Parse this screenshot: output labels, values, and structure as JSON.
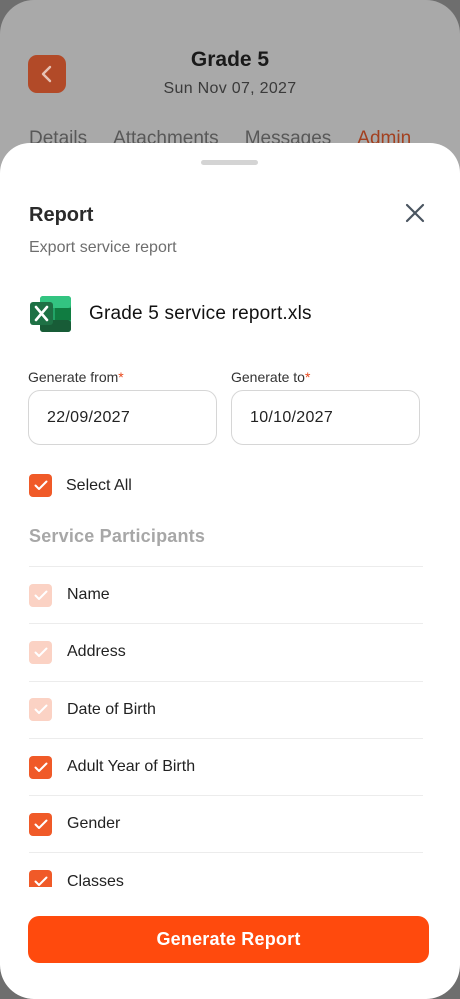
{
  "header": {
    "title": "Grade 5",
    "date": "Sun Nov 07, 2027",
    "tabs": [
      {
        "label": "Details"
      },
      {
        "label": "Attachments"
      },
      {
        "label": "Messages"
      },
      {
        "label": "Admin",
        "active": true
      }
    ]
  },
  "sheet": {
    "title": "Report",
    "subtitle": "Export service report",
    "file_name": "Grade 5 service report.xls",
    "file_icon": "excel-icon",
    "from_label": "Generate from",
    "from_value": "22/09/2027",
    "to_label": "Generate to",
    "to_value": "10/10/2027",
    "required_mark": "*",
    "select_all_label": "Select All",
    "section_title": "Service Participants",
    "items": [
      {
        "label": "Name",
        "checked": true,
        "disabled": true
      },
      {
        "label": "Address",
        "checked": true,
        "disabled": true
      },
      {
        "label": "Date of Birth",
        "checked": true,
        "disabled": true
      },
      {
        "label": "Adult Year of Birth",
        "checked": true,
        "disabled": false
      },
      {
        "label": "Gender",
        "checked": true,
        "disabled": false
      },
      {
        "label": "Classes",
        "checked": true,
        "disabled": false
      }
    ],
    "generate_label": "Generate Report"
  },
  "colors": {
    "accent": "#ff4a0d",
    "checkbox": "#f05a28",
    "checkbox_disabled": "#fbd2c4",
    "excel_green": "#1e7145"
  }
}
